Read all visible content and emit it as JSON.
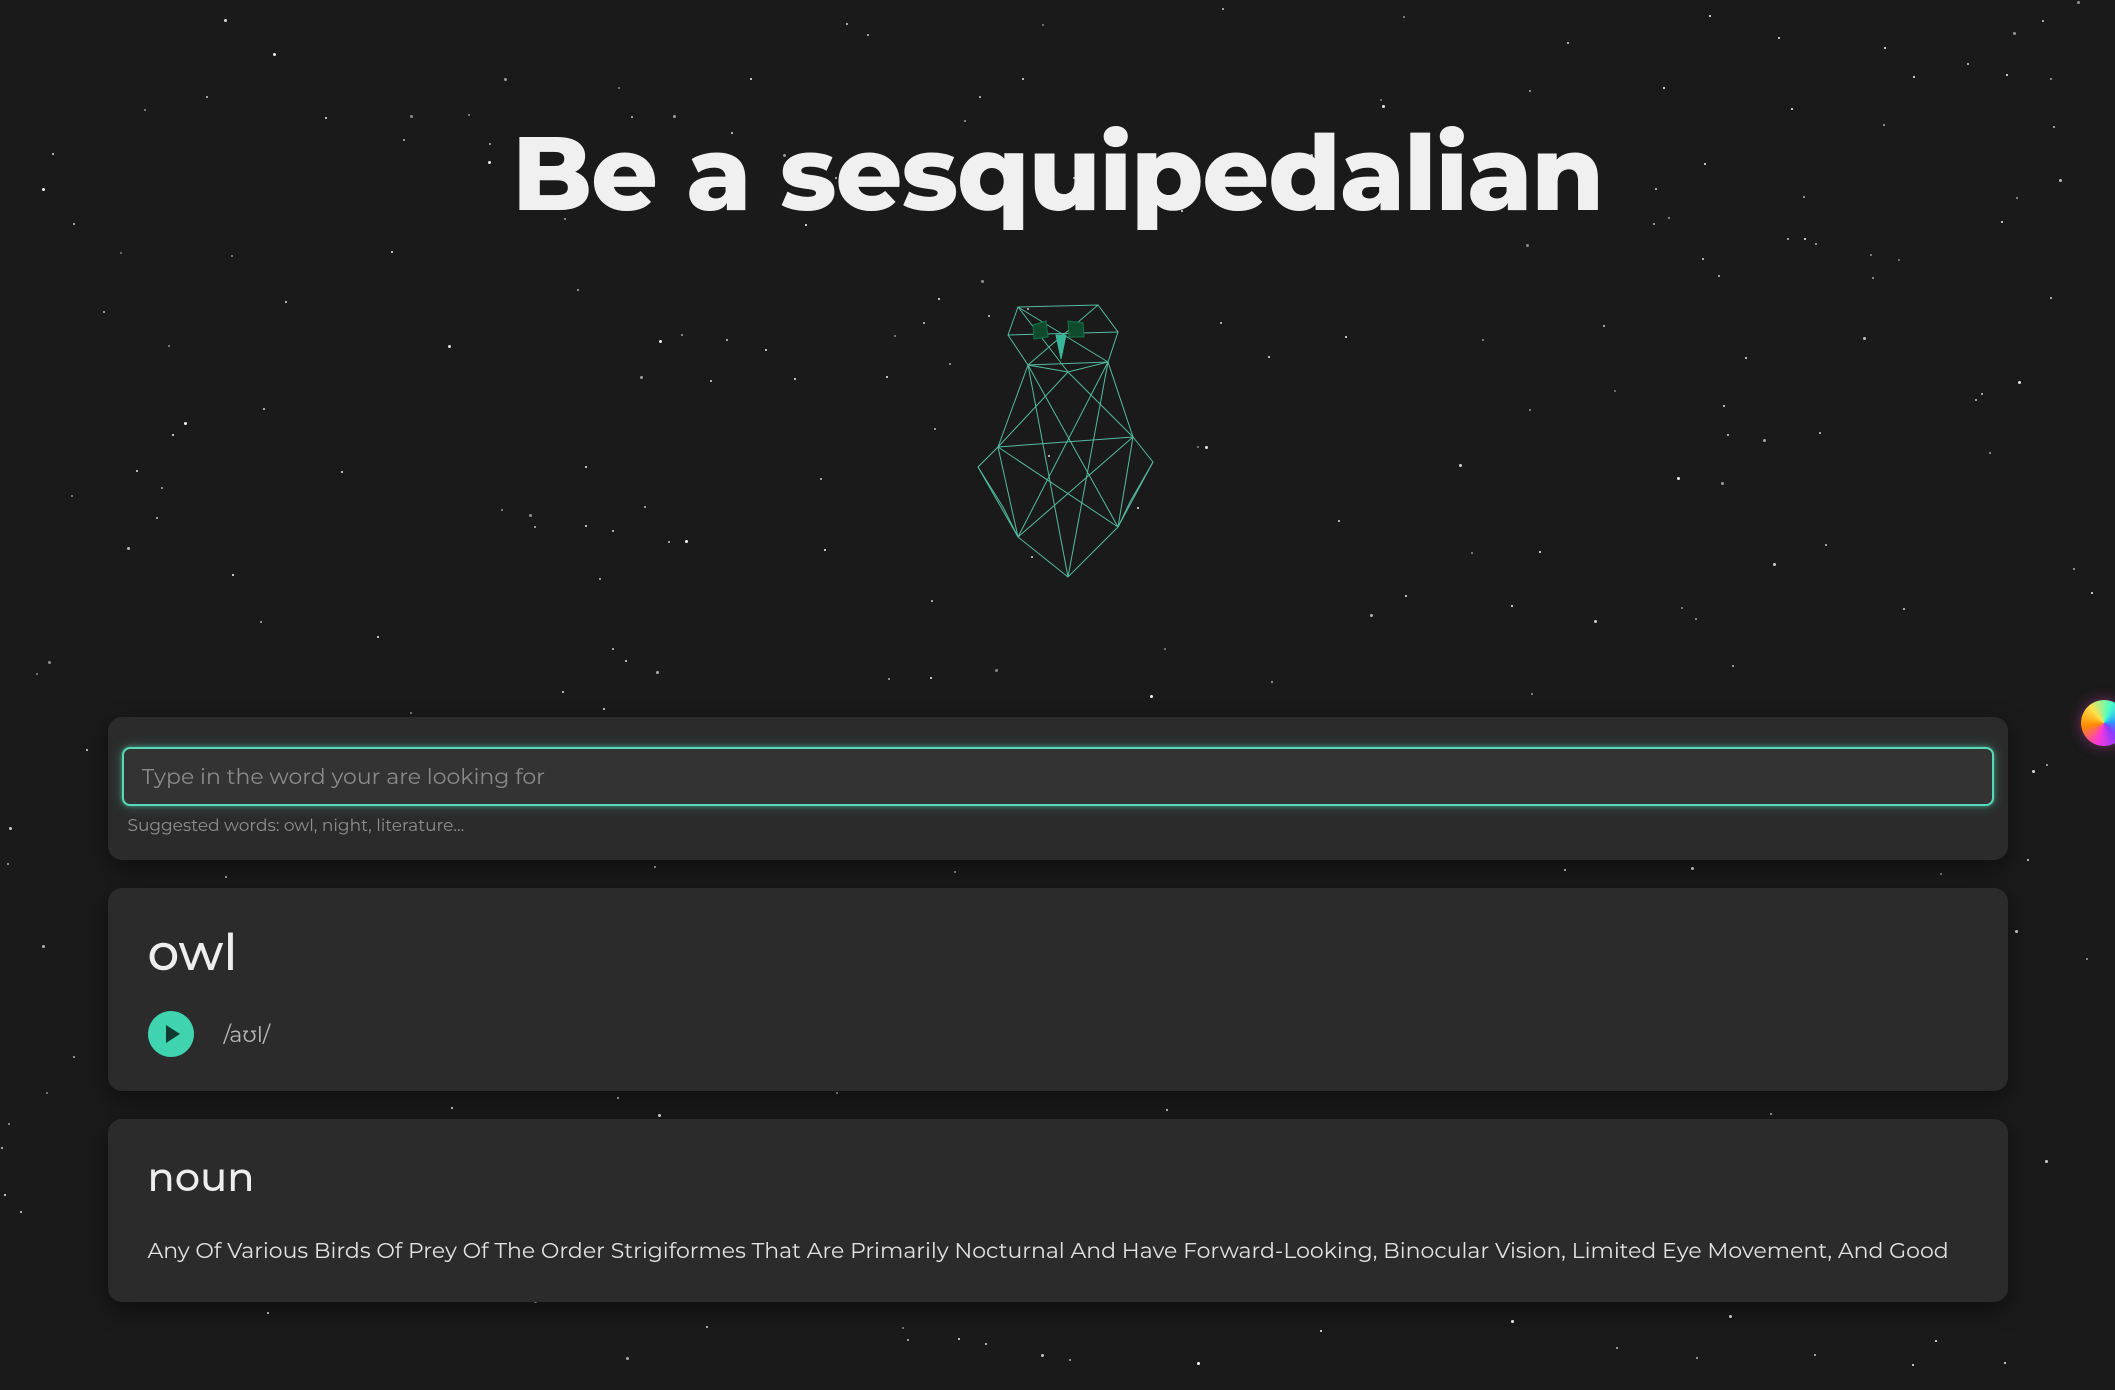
{
  "header": {
    "title": "Be a sesquipedalian"
  },
  "search": {
    "placeholder": "Type in the word your are looking for",
    "value": "",
    "suggestion_text": "Suggested words: owl, night, literature..."
  },
  "entry": {
    "word": "owl",
    "phonetic": "/aʊl/"
  },
  "definition_block": {
    "part_of_speech": "noun",
    "text": "Any Of Various Birds Of Prey Of The Order Strigiformes That Are Primarily Nocturnal And Have Forward-Looking, Binocular Vision, Limited Eye Movement, And Good"
  },
  "icons": {
    "play": "play-icon",
    "orb": "assistant-orb"
  }
}
